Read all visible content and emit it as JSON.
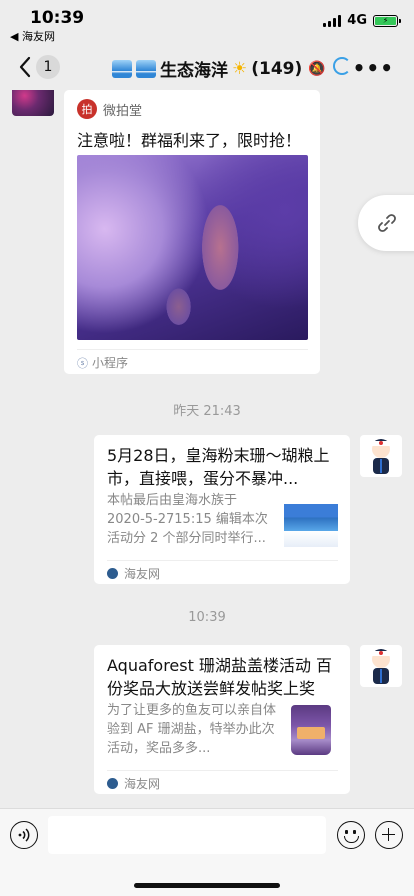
{
  "status_bar": {
    "time": "10:39",
    "back_app": "◀ 海友网",
    "network": "4G"
  },
  "nav": {
    "unread_count": "1",
    "title": "生态海洋",
    "member_count": "(149)"
  },
  "messages": {
    "mini_program": {
      "source": "微拍堂",
      "title": "注意啦！群福利来了，限时抢！",
      "footer": "小程序"
    },
    "timestamp1": "昨天 21:43",
    "link1": {
      "title": "5月28日，皇海粉末珊～瑚粮上市，直接喂，蛋分不暴冲...",
      "description": "本帖最后由皇海水族于 2020-5-2715:15 编辑本次活动分 2 个部分同时举行...",
      "source": "海友网"
    },
    "timestamp2": "10:39",
    "link2": {
      "title": "Aquaforest 珊湖盐盖楼活动 百份奖品大放送尝鲜发帖奖上奖",
      "description": "为了让更多的鱼友可以亲自体验到 AF 珊湖盐，特举办此次活动，奖品多多...",
      "source": "海友网"
    }
  },
  "colors": {
    "background": "#ededed",
    "card": "#ffffff",
    "muted_text": "#888888",
    "battery": "#34c759"
  }
}
